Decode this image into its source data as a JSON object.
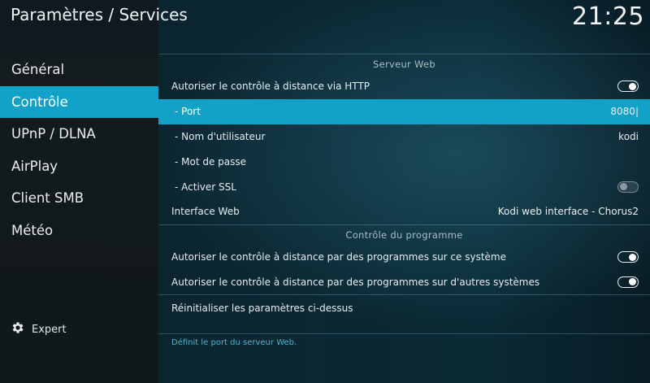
{
  "header": {
    "title": "Paramètres / Services",
    "clock": "21:25"
  },
  "sidebar": {
    "items": [
      {
        "label": "Général",
        "active": false
      },
      {
        "label": "Contrôle",
        "active": true
      },
      {
        "label": "UPnP / DLNA",
        "active": false
      },
      {
        "label": "AirPlay",
        "active": false
      },
      {
        "label": "Client SMB",
        "active": false
      },
      {
        "label": "Météo",
        "active": false
      }
    ],
    "expert_label": "Expert",
    "expert_icon": "gear-icon"
  },
  "main": {
    "sections": [
      {
        "title": "Serveur Web",
        "rows": [
          {
            "label": "Autoriser le contrôle à distance via HTTP",
            "type": "toggle",
            "on": true
          },
          {
            "label": "- Port",
            "type": "value",
            "value": "8080|",
            "active": true
          },
          {
            "label": "- Nom d'utilisateur",
            "type": "value",
            "value": "kodi"
          },
          {
            "label": "- Mot de passe",
            "type": "value",
            "value": ""
          },
          {
            "label": "- Activer SSL",
            "type": "toggle",
            "on": false
          },
          {
            "label": "Interface Web",
            "type": "value",
            "value": "Kodi web interface - Chorus2"
          }
        ]
      },
      {
        "title": "Contrôle du programme",
        "rows": [
          {
            "label": "Autoriser le contrôle à distance par des programmes sur ce système",
            "type": "toggle",
            "on": true
          },
          {
            "label": "Autoriser le contrôle à distance par des programmes sur d'autres systèmes",
            "type": "toggle",
            "on": true
          },
          {
            "label": "Réinitialiser les paramètres ci-dessus",
            "type": "action"
          }
        ]
      }
    ],
    "description": "Définit le port du serveur Web."
  },
  "colors": {
    "accent": "#12a2c7",
    "description_text": "#4fb3cf"
  }
}
